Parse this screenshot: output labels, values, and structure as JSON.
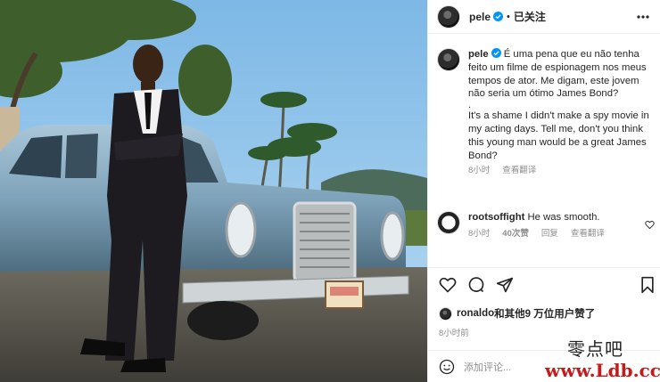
{
  "post": {
    "username": "pele",
    "separator": "•",
    "follow_status": "已关注"
  },
  "caption": {
    "username": "pele",
    "text_pt": "É uma pena que eu não tenha feito um filme de espionagem nos meus tempos de ator. Me digam, este jovem não seria um ótimo James Bond?",
    "dot": ".",
    "text_en": "It's a shame I didn't make a spy movie in my acting days. Tell me, don't you think this young man would be a great James Bond?",
    "age": "8小时",
    "see_translation": "查看翻译"
  },
  "comments": [
    {
      "username": "rootsoffight",
      "text": "He was smooth.",
      "age": "8小时",
      "likes": "40次赞",
      "reply": "回复",
      "see_translation": "查看翻译"
    }
  ],
  "likes": {
    "lead_user": "ronaldo",
    "rest": "和其他9 万位用户赞了"
  },
  "post_time": "8小时前",
  "add_comment": {
    "placeholder": "添加评论..."
  },
  "watermark": {
    "line1": "零点吧",
    "line2": "www.Ldb.cc"
  },
  "icons": [
    "more-icon",
    "verified-icon",
    "heart-icon",
    "comment-icon",
    "share-icon",
    "bookmark-icon",
    "emoji-icon"
  ],
  "colors": {
    "verified": "#0095f6",
    "muted": "#8e8e8e",
    "text": "#262626",
    "watermark_red": "#c41a1a"
  }
}
